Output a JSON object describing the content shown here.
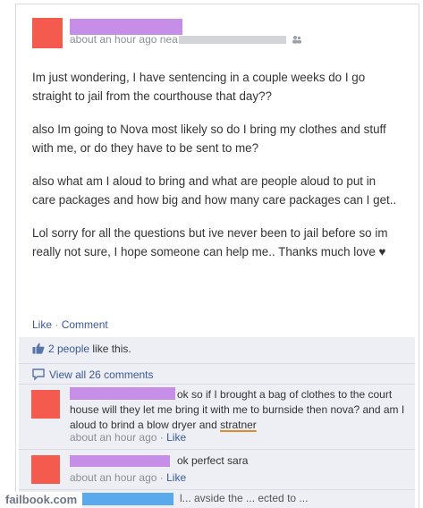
{
  "post": {
    "timestamp": "about an hour ago",
    "location_prefix": "nea",
    "paragraphs": [
      "Im just wondering, I have sentencing in a couple weeks do I go straight to jail from the courthouse that day??",
      "also Im going to Nova most likely so do I bring my clothes and stuff with me, or do they have to be sent to me?",
      "also what am I aloud to bring and what are people aloud to put in care packages and how big and how many care packages can I get..",
      "Lol sorry for all the questions but ive never been to jail before so im really not sure, I hope someone can help me.. Thanks much love ♥"
    ],
    "actions": {
      "like": "Like",
      "separator": "·",
      "comment": "Comment"
    }
  },
  "feedback": {
    "likes_count": "2 people",
    "likes_suffix": " like this.",
    "view_all": "View all 26 comments"
  },
  "comments": [
    {
      "text_before": "ok so if I brought a bag of clothes to the court house will they let me bring it with me to burnside then nova? and am I aloud to brind a blow dryer and ",
      "text_misspelled": "stratner",
      "timestamp": "about an hour ago",
      "like": "Like"
    },
    {
      "text": "ok perfect sara",
      "timestamp": "about an hour ago",
      "like": "Like"
    },
    {
      "text_partial": "l... avside the ... ected to ..."
    }
  ],
  "watermark": "failbook.com",
  "colors": {
    "link": "#3b5998",
    "redact_name": "#c78ee8",
    "avatar": "#f55a4e",
    "feedback_bg": "#edeff4"
  }
}
